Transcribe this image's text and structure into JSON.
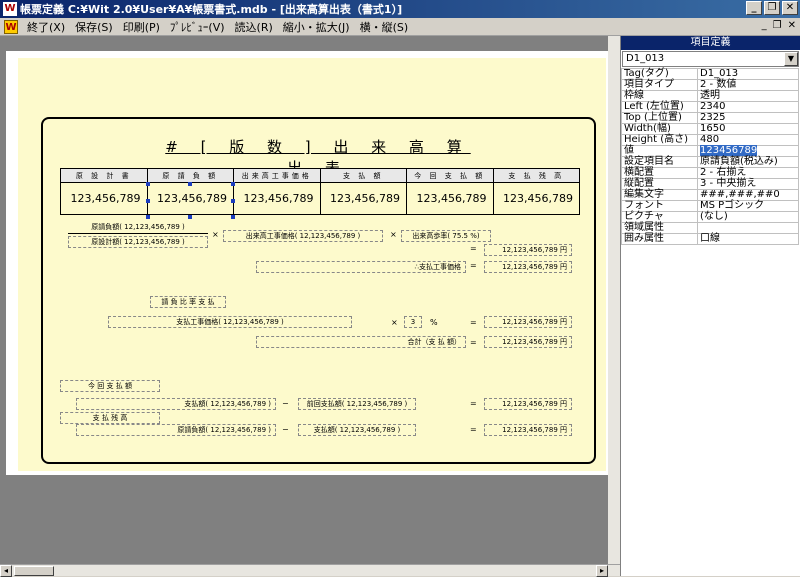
{
  "window": {
    "title": "帳票定義 C:¥Wit 2.0¥User¥A¥帳票書式.mdb - [出来高算出表（書式1）]",
    "icon": "W"
  },
  "menu": {
    "items": [
      "終了(X)",
      "保存(S)",
      "印刷(P)",
      "ﾌﾟﾚﾋﾞｭｰ(V)",
      "読込(R)",
      "縮小・拡大(J)",
      "横・縦(S)"
    ]
  },
  "report": {
    "title": "# [ 版 数 ] 出 来 高 算 出 表",
    "headers": [
      "原 設 計 書",
      "原 請 負 額",
      "出来高工事価格",
      "支 払 額",
      "今 回 支 払 額",
      "支 払 残 高"
    ],
    "values": [
      "123,456,789",
      "123,456,789",
      "123,456,789",
      "123,456,789",
      "123,456,789",
      "123,456,789"
    ],
    "f1": "原請負額( 12,123,456,789 )",
    "f2": "原設計額( 12,123,456,789 )",
    "times": "×",
    "f3": "出来高工事価格( 12,123,456,789 )",
    "f4": "出来高歩率( 75.5 %)",
    "eq": "=",
    "r1": "12,123,456,789 円",
    "r2": "12,123,456,789 円",
    "l_kojika": "∴支払工事価格",
    "sec_shiharai_hiritsu": "請 負 比 率 支 払",
    "f5": "支払工事価格( 12,123,456,789 )",
    "pct_val": "3",
    "pct_unit": "%",
    "r3": "12,123,456,789 円",
    "l_goukei": "合計（支 払 額）",
    "r4": "12,123,456,789 円",
    "sec_konkai": "今 回 支 払 額",
    "f6": "支払額( 12,123,456,789 )",
    "minus": "−",
    "f7": "前回支払額( 12,123,456,789 )",
    "r5": "12,123,456,789 円",
    "sec_zan": "支 払 残 高",
    "f8": "原請負額( 12,123,456,789 )",
    "f9": "支払額( 12,123,456,789 )",
    "r6": "12,123,456,789 円"
  },
  "panel": {
    "title": "項目定義",
    "selected": "D1_013",
    "props": [
      {
        "k": "Tag(タグ)",
        "v": "D1_013"
      },
      {
        "k": "項目タイプ",
        "v": "2 - 数値"
      },
      {
        "k": "枠線",
        "v": "透明"
      },
      {
        "k": "Left (左位置)",
        "v": "2340"
      },
      {
        "k": "Top (上位置)",
        "v": "2325"
      },
      {
        "k": "Width(幅)",
        "v": "1650"
      },
      {
        "k": "Height (高さ)",
        "v": "480"
      },
      {
        "k": "値",
        "v": "123456789"
      },
      {
        "k": "設定項目名",
        "v": "原請負額(税込み)"
      },
      {
        "k": "横配置",
        "v": "2 - 右揃え"
      },
      {
        "k": "縦配置",
        "v": "3 - 中央揃え"
      },
      {
        "k": "編集文字",
        "v": "###,###,##0"
      },
      {
        "k": "フォント",
        "v": "MS Pゴシック"
      },
      {
        "k": "ピクチャ",
        "v": "(なし)"
      },
      {
        "k": "領域属性",
        "v": ""
      },
      {
        "k": "囲み属性",
        "v": "口線"
      }
    ]
  }
}
